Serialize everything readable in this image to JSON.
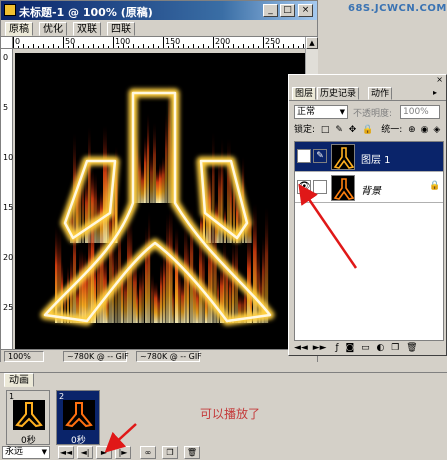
{
  "document": {
    "title": "未标题-1 @ 100% (原稿)",
    "tabs": [
      "原稿",
      "优化",
      "双联",
      "四联"
    ],
    "ruler_top_labels": [
      "0",
      "50",
      "100",
      "150",
      "200",
      "250"
    ],
    "ruler_left_labels": [
      "0",
      "5",
      "10",
      "15",
      "20",
      "25"
    ],
    "status": {
      "zoom": "100%",
      "field1": "~780K @ -- GIF",
      "field2": "~780K @ -- GIF"
    }
  },
  "watermark": "68S.JCWCN.COM",
  "layers_panel": {
    "tabs": [
      "图层",
      "历史记录",
      "动作"
    ],
    "blend_mode": "正常",
    "opacity_label": "不透明度:",
    "opacity_value": "100%",
    "lock_label": "锁定:",
    "unify_label": "统一:",
    "layers": [
      {
        "name": "图层 1",
        "selected": true,
        "visible": false
      },
      {
        "name": "背景",
        "selected": false,
        "visible": true
      }
    ]
  },
  "animation": {
    "tab": "动画",
    "frames": [
      {
        "number": "1",
        "delay": "0秒"
      },
      {
        "number": "2",
        "delay": "0秒"
      }
    ],
    "note": "可以播放了",
    "loop": "永远"
  },
  "colors": {
    "titlebar": "#0a246a",
    "selection": "#0a246a",
    "note": "#c43a3a",
    "arrow": "#e01818"
  }
}
